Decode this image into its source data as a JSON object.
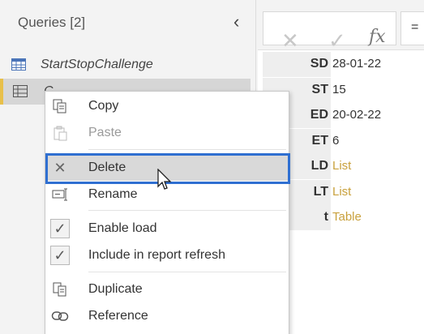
{
  "queries_pane": {
    "title": "Queries [2]",
    "collapse_icon": "chevron-left-icon",
    "items": [
      {
        "label": "StartStopChallenge",
        "icon": "table-icon"
      },
      {
        "label": "C",
        "icon": "table-grid-icon",
        "selected": true
      }
    ]
  },
  "toolbar": {
    "cancel_icon": "close-icon",
    "commit_icon": "check-icon",
    "fx_label": "fx",
    "equals": "="
  },
  "record": {
    "rows": [
      {
        "key": "SD",
        "value": "28-01-22",
        "is_link": false
      },
      {
        "key": "ST",
        "value": "15",
        "is_link": false
      },
      {
        "key": "ED",
        "value": "20-02-22",
        "is_link": false
      },
      {
        "key": "ET",
        "value": "6",
        "is_link": false
      },
      {
        "key": "LD",
        "value": "List",
        "is_link": true
      },
      {
        "key": "LT",
        "value": "List",
        "is_link": true
      },
      {
        "key": "t",
        "value": "Table",
        "is_link": true
      }
    ],
    "link_color": "#c9a13d"
  },
  "context_menu": {
    "copy": "Copy",
    "paste": "Paste",
    "delete": "Delete",
    "rename": "Rename",
    "enable_load": "Enable load",
    "include_refresh": "Include in report refresh",
    "duplicate": "Duplicate",
    "reference": "Reference",
    "highlight_color": "#2f6fd1"
  }
}
